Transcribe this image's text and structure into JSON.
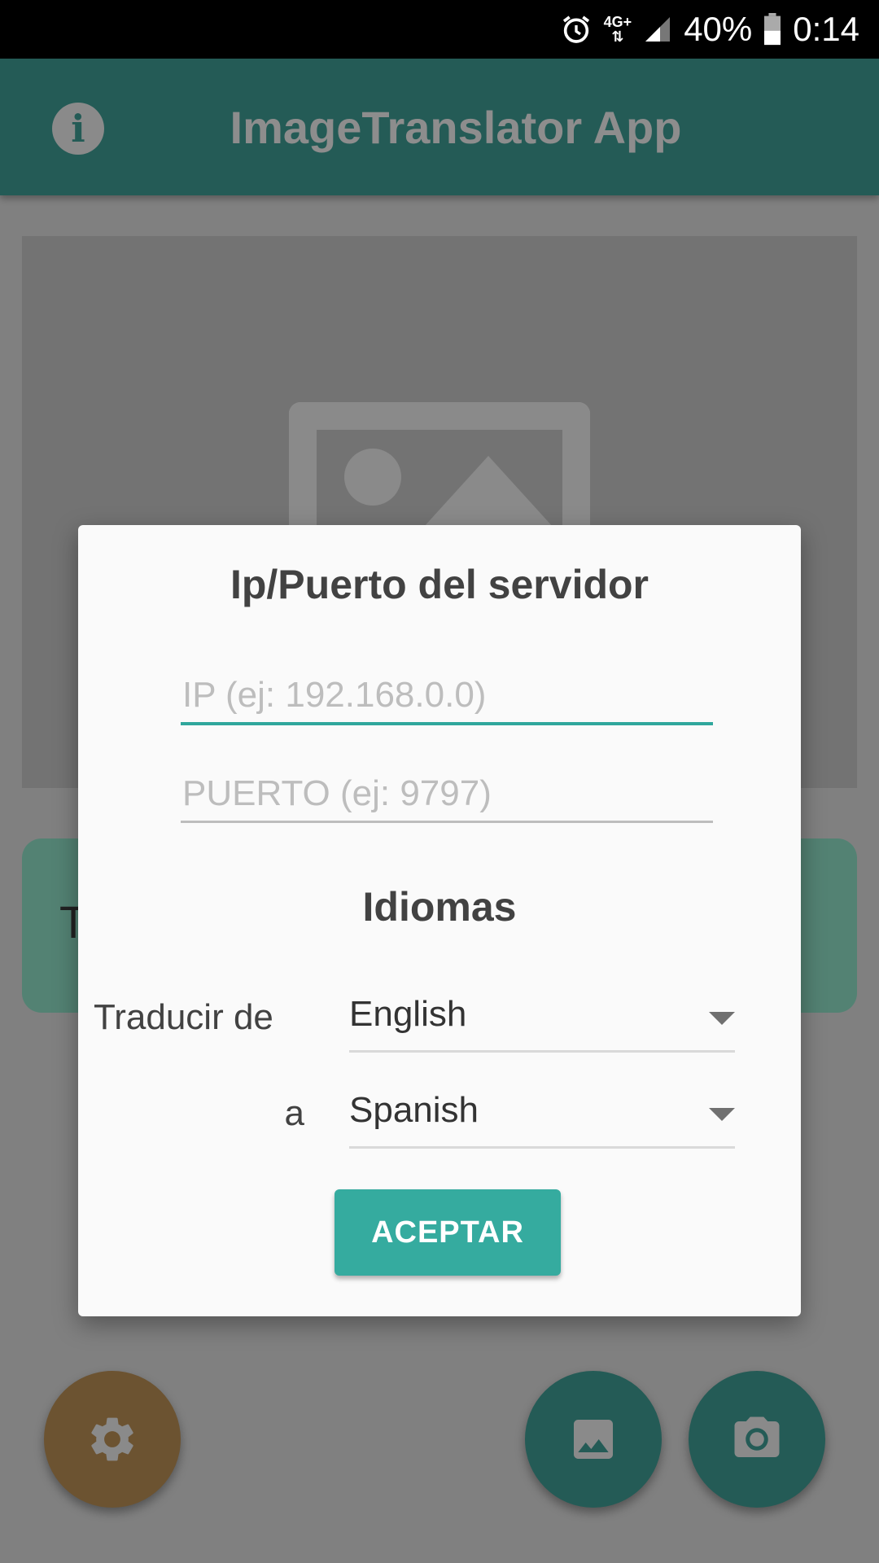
{
  "status_bar": {
    "network": "4G+",
    "battery": "40%",
    "time": "0:14",
    "icons": [
      "alarm-icon",
      "signal-icon",
      "battery-icon"
    ]
  },
  "app_bar": {
    "title": "ImageTranslator App",
    "info_icon": "info-icon"
  },
  "background": {
    "result_text": "T"
  },
  "dialog": {
    "title": "Ip/Puerto del servidor",
    "ip_placeholder": "IP (ej: 192.168.0.0)",
    "ip_value": "",
    "port_placeholder": "PUERTO (ej: 9797)",
    "port_value": "",
    "languages_title": "Idiomas",
    "from_label": "Traducir de",
    "from_value": "English",
    "to_label": "a",
    "to_value": "Spanish",
    "accept_label": "ACEPTAR"
  },
  "fabs": [
    "gear-icon",
    "image-icon",
    "camera-icon"
  ],
  "colors": {
    "accent": "#35ab9f",
    "app_bar": "#245b56",
    "settings_fab": "#6c5331"
  }
}
